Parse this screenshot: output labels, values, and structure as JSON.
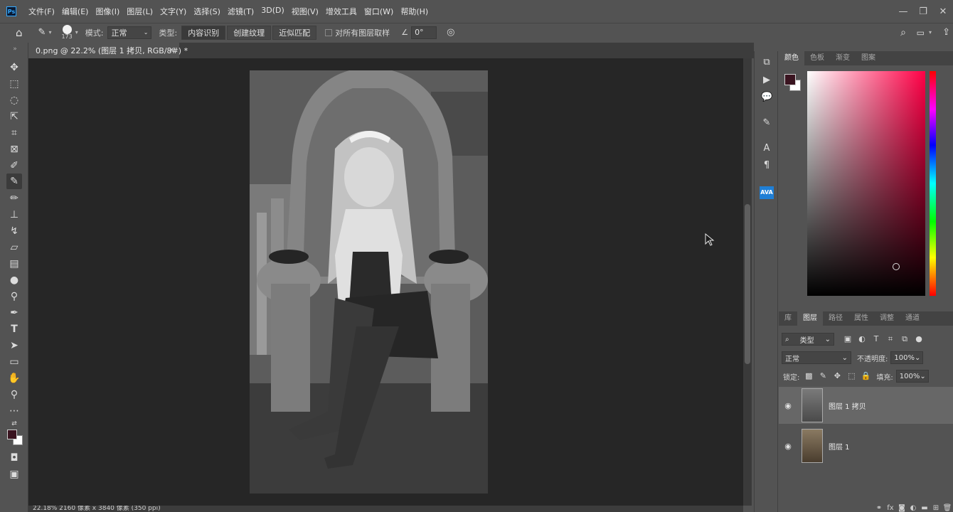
{
  "app": {
    "logo": "Ps",
    "menus": [
      "文件(F)",
      "编辑(E)",
      "图像(I)",
      "图层(L)",
      "文字(Y)",
      "选择(S)",
      "滤镜(T)",
      "3D(D)",
      "视图(V)",
      "增效工具",
      "窗口(W)",
      "帮助(H)"
    ]
  },
  "options_bar": {
    "brush_size": "173",
    "mode_label": "模式:",
    "mode_value": "正常",
    "type_label": "类型:",
    "type_buttons": [
      "内容识别",
      "创建纹理",
      "近似匹配"
    ],
    "sample_all_label": "对所有图层取样",
    "angle_value": "0°"
  },
  "document": {
    "tab_title": "0.png @ 22.2% (图层 1 拷贝, RGB/8#) *",
    "status": "22.18%    2160 像素 x 3840 像素 (350 ppi)"
  },
  "color_panel": {
    "tabs": [
      "颜色",
      "色板",
      "渐变",
      "图案"
    ],
    "active_tab": "颜色",
    "foreground": "#3a1420",
    "background": "#ffffff"
  },
  "layers_panel": {
    "tabs": [
      "库",
      "图层",
      "路径",
      "属性",
      "调整",
      "通道"
    ],
    "active_tab": "图层",
    "filter_label": "类型",
    "blend_mode": "正常",
    "opacity_label": "不透明度:",
    "opacity_value": "100%",
    "lock_label": "锁定:",
    "fill_label": "填充:",
    "fill_value": "100%",
    "layers": [
      {
        "name": "图层 1 拷贝",
        "selected": true
      },
      {
        "name": "图层 1",
        "selected": false
      }
    ]
  }
}
